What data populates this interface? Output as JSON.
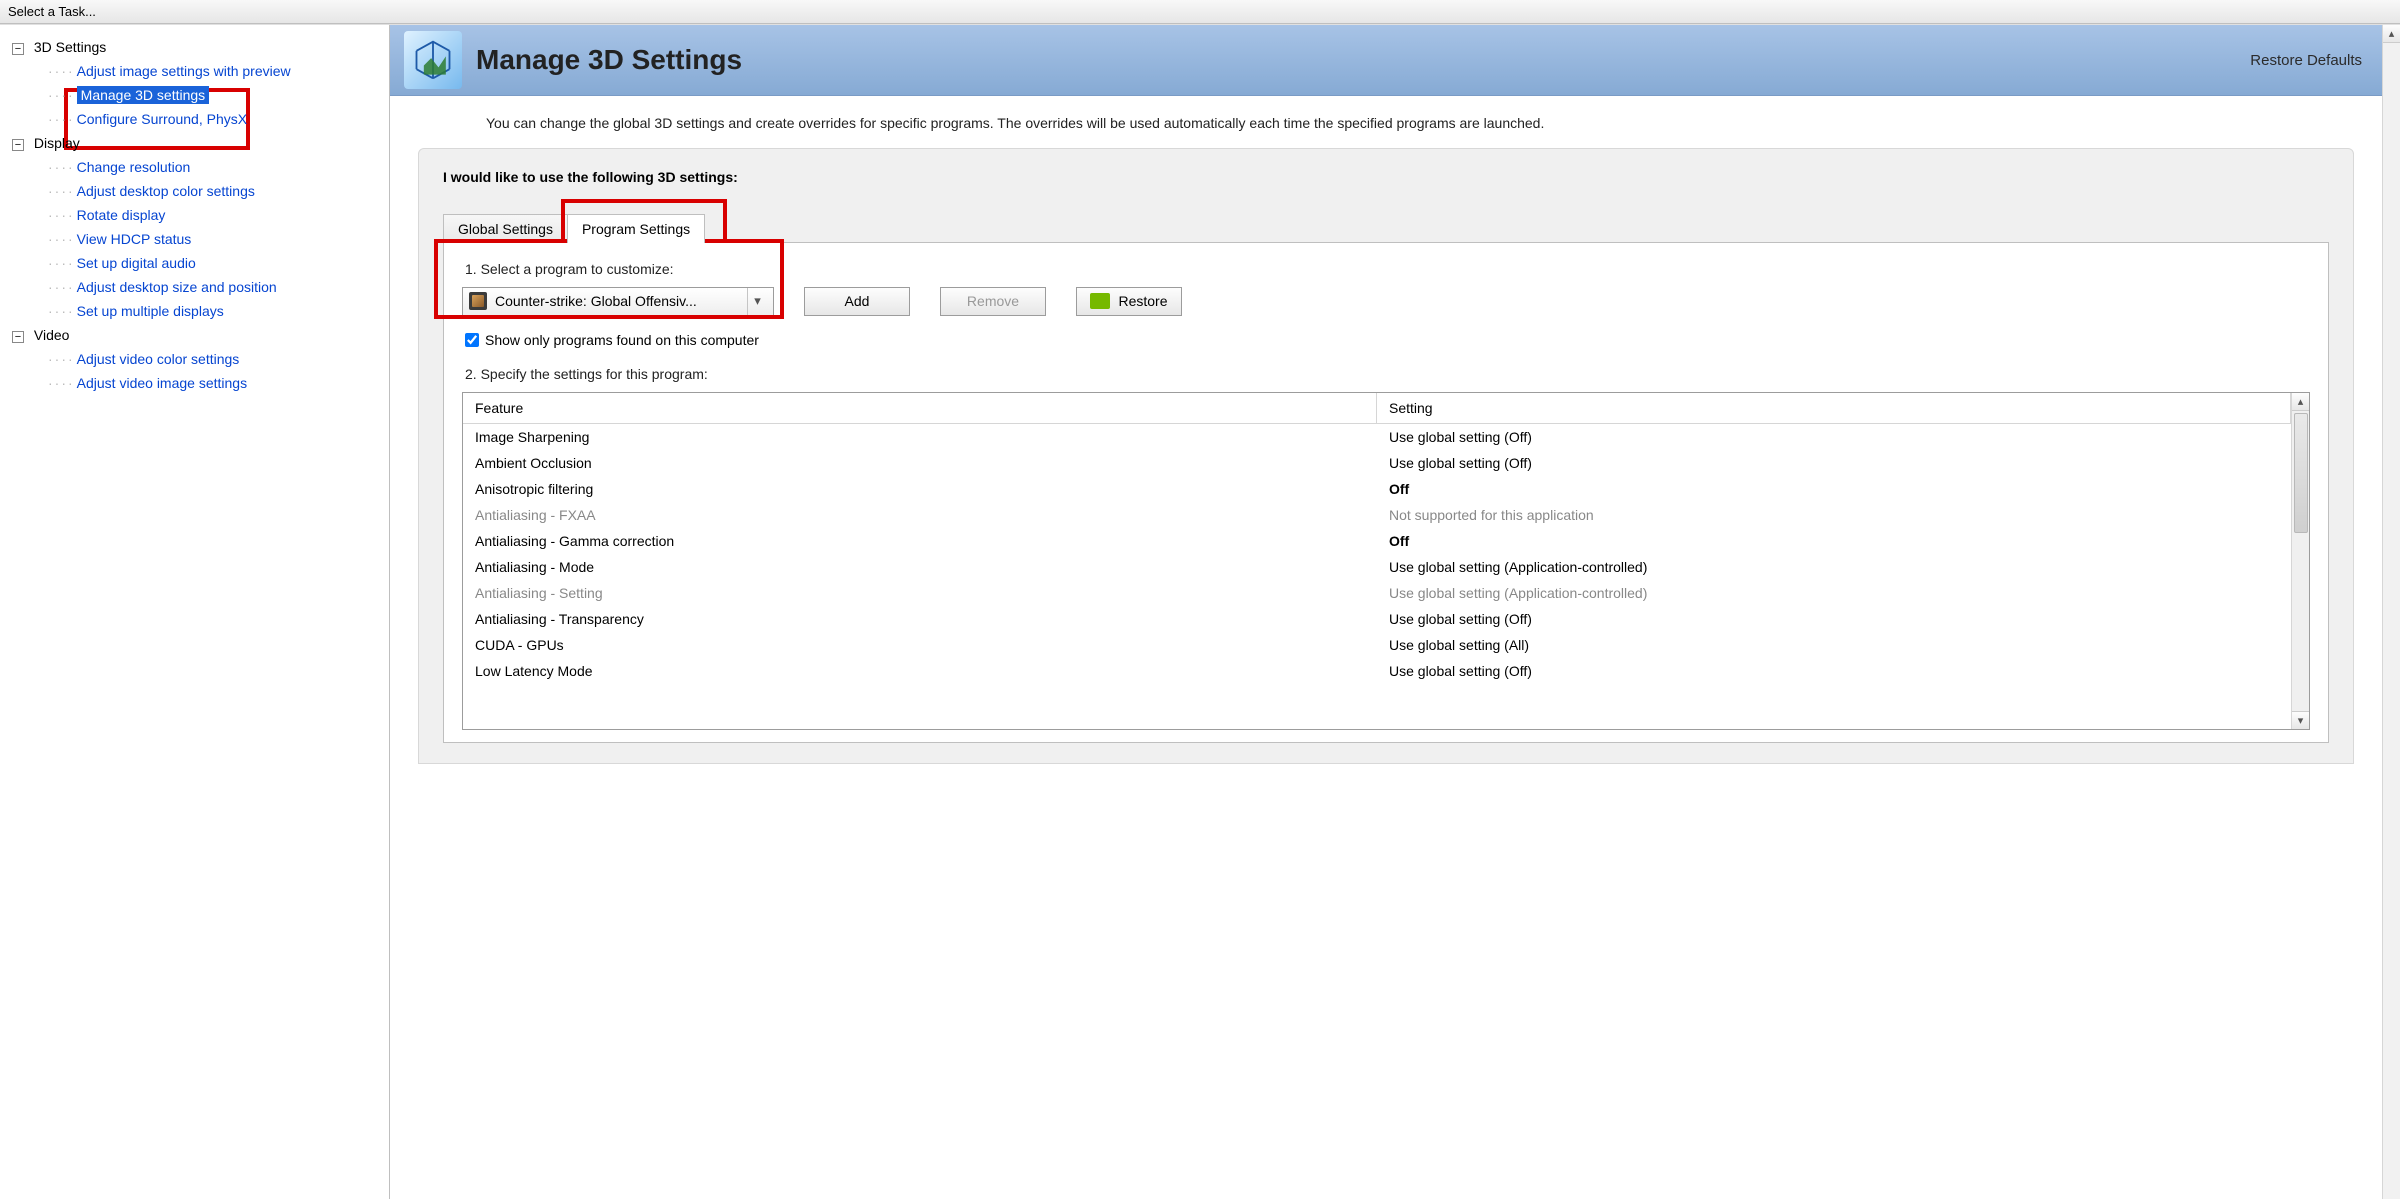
{
  "sidebar": {
    "title": "Select a Task...",
    "categories": [
      {
        "label": "3D Settings",
        "items": [
          {
            "label": "Adjust image settings with preview",
            "selected": false
          },
          {
            "label": "Manage 3D settings",
            "selected": true
          },
          {
            "label": "Configure Surround, PhysX",
            "selected": false
          }
        ]
      },
      {
        "label": "Display",
        "items": [
          {
            "label": "Change resolution"
          },
          {
            "label": "Adjust desktop color settings"
          },
          {
            "label": "Rotate display"
          },
          {
            "label": "View HDCP status"
          },
          {
            "label": "Set up digital audio"
          },
          {
            "label": "Adjust desktop size and position"
          },
          {
            "label": "Set up multiple displays"
          }
        ]
      },
      {
        "label": "Video",
        "items": [
          {
            "label": "Adjust video color settings"
          },
          {
            "label": "Adjust video image settings"
          }
        ]
      }
    ]
  },
  "header": {
    "title": "Manage 3D Settings",
    "restore_defaults": "Restore Defaults"
  },
  "intro": "You can change the global 3D settings and create overrides for specific programs. The overrides will be used automatically each time the specified programs are launched.",
  "panel": {
    "heading": "I would like to use the following 3D settings:",
    "tabs": {
      "global": "Global Settings",
      "program": "Program Settings"
    },
    "step1_label": "1. Select a program to customize:",
    "program_selected": "Counter-strike: Global Offensiv...",
    "buttons": {
      "add": "Add",
      "remove": "Remove",
      "restore": "Restore"
    },
    "show_only_label": "Show only programs found on this computer",
    "show_only_checked": true,
    "step2_label": "2. Specify the settings for this program:",
    "table": {
      "headers": {
        "feature": "Feature",
        "setting": "Setting"
      },
      "rows": [
        {
          "feature": "Image Sharpening",
          "setting": "Use global setting (Off)"
        },
        {
          "feature": "Ambient Occlusion",
          "setting": "Use global setting (Off)"
        },
        {
          "feature": "Anisotropic filtering",
          "setting": "Off",
          "bold": true
        },
        {
          "feature": "Antialiasing - FXAA",
          "setting": "Not supported for this application",
          "disabled": true
        },
        {
          "feature": "Antialiasing - Gamma correction",
          "setting": "Off",
          "bold": true
        },
        {
          "feature": "Antialiasing - Mode",
          "setting": "Use global setting (Application-controlled)"
        },
        {
          "feature": "Antialiasing - Setting",
          "setting": "Use global setting (Application-controlled)",
          "disabled": true
        },
        {
          "feature": "Antialiasing - Transparency",
          "setting": "Use global setting (Off)"
        },
        {
          "feature": "CUDA - GPUs",
          "setting": "Use global setting (All)"
        },
        {
          "feature": "Low Latency Mode",
          "setting": "Use global setting (Off)"
        }
      ]
    }
  }
}
